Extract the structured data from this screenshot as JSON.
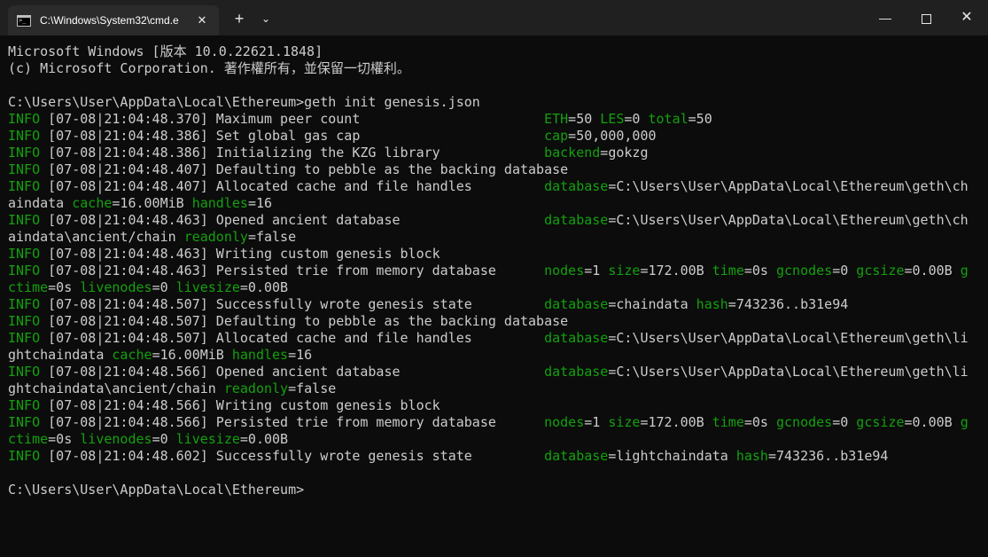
{
  "window": {
    "tab_title": "C:\\Windows\\System32\\cmd.e",
    "tab_close": "✕",
    "new_tab": "+",
    "dropdown": "⌄",
    "minimize": "—",
    "close": "✕"
  },
  "colors": {
    "background": "#0c0c0c",
    "text": "#cccccc",
    "green": "#13a10e",
    "titlebar": "#202020"
  },
  "lines": [
    {
      "segs": [
        {
          "t": "Microsoft Windows [版本 10.0.22621.1848]"
        }
      ]
    },
    {
      "segs": [
        {
          "t": "(c) Microsoft Corporation. 著作權所有，並保留一切權利。"
        }
      ]
    },
    {
      "segs": [
        {
          "t": ""
        }
      ]
    },
    {
      "segs": [
        {
          "t": "C:\\Users\\User\\AppData\\Local\\Ethereum>geth init genesis.json"
        }
      ]
    },
    {
      "segs": [
        {
          "t": "INFO",
          "c": "lv"
        },
        {
          "t": " [07-08|21:04:48.370] Maximum peer count                       "
        },
        {
          "t": "ETH",
          "c": "k"
        },
        {
          "t": "=50 "
        },
        {
          "t": "LES",
          "c": "k"
        },
        {
          "t": "=0 "
        },
        {
          "t": "total",
          "c": "k"
        },
        {
          "t": "=50"
        }
      ]
    },
    {
      "segs": [
        {
          "t": "INFO",
          "c": "lv"
        },
        {
          "t": " [07-08|21:04:48.386] Set global gas cap                       "
        },
        {
          "t": "cap",
          "c": "k"
        },
        {
          "t": "=50,000,000"
        }
      ]
    },
    {
      "segs": [
        {
          "t": "INFO",
          "c": "lv"
        },
        {
          "t": " [07-08|21:04:48.386] Initializing the KZG library             "
        },
        {
          "t": "backend",
          "c": "k"
        },
        {
          "t": "=gokzg"
        }
      ]
    },
    {
      "segs": [
        {
          "t": "INFO",
          "c": "lv"
        },
        {
          "t": " [07-08|21:04:48.407] Defaulting to pebble as the backing database"
        }
      ]
    },
    {
      "segs": [
        {
          "t": "INFO",
          "c": "lv"
        },
        {
          "t": " [07-08|21:04:48.407] Allocated cache and file handles         "
        },
        {
          "t": "database",
          "c": "k"
        },
        {
          "t": "=C:\\Users\\User\\AppData\\Local\\Ethereum\\geth\\ch"
        }
      ]
    },
    {
      "segs": [
        {
          "t": "aindata "
        },
        {
          "t": "cache",
          "c": "k"
        },
        {
          "t": "=16.00MiB "
        },
        {
          "t": "handles",
          "c": "k"
        },
        {
          "t": "=16"
        }
      ]
    },
    {
      "segs": [
        {
          "t": "INFO",
          "c": "lv"
        },
        {
          "t": " [07-08|21:04:48.463] Opened ancient database                  "
        },
        {
          "t": "database",
          "c": "k"
        },
        {
          "t": "=C:\\Users\\User\\AppData\\Local\\Ethereum\\geth\\ch"
        }
      ]
    },
    {
      "segs": [
        {
          "t": "aindata\\ancient/chain "
        },
        {
          "t": "readonly",
          "c": "k"
        },
        {
          "t": "=false"
        }
      ]
    },
    {
      "segs": [
        {
          "t": "INFO",
          "c": "lv"
        },
        {
          "t": " [07-08|21:04:48.463] Writing custom genesis block"
        }
      ]
    },
    {
      "segs": [
        {
          "t": "INFO",
          "c": "lv"
        },
        {
          "t": " [07-08|21:04:48.463] Persisted trie from memory database      "
        },
        {
          "t": "nodes",
          "c": "k"
        },
        {
          "t": "=1 "
        },
        {
          "t": "size",
          "c": "k"
        },
        {
          "t": "=172.00B "
        },
        {
          "t": "time",
          "c": "k"
        },
        {
          "t": "=0s "
        },
        {
          "t": "gcnodes",
          "c": "k"
        },
        {
          "t": "=0 "
        },
        {
          "t": "gcsize",
          "c": "k"
        },
        {
          "t": "=0.00B "
        },
        {
          "t": "g",
          "c": "k"
        }
      ]
    },
    {
      "segs": [
        {
          "t": "ctime",
          "c": "k"
        },
        {
          "t": "=0s "
        },
        {
          "t": "livenodes",
          "c": "k"
        },
        {
          "t": "=0 "
        },
        {
          "t": "livesize",
          "c": "k"
        },
        {
          "t": "=0.00B"
        }
      ]
    },
    {
      "segs": [
        {
          "t": "INFO",
          "c": "lv"
        },
        {
          "t": " [07-08|21:04:48.507] Successfully wrote genesis state         "
        },
        {
          "t": "database",
          "c": "k"
        },
        {
          "t": "=chaindata "
        },
        {
          "t": "hash",
          "c": "k"
        },
        {
          "t": "=743236..b31e94"
        }
      ]
    },
    {
      "segs": [
        {
          "t": "INFO",
          "c": "lv"
        },
        {
          "t": " [07-08|21:04:48.507] Defaulting to pebble as the backing database"
        }
      ]
    },
    {
      "segs": [
        {
          "t": "INFO",
          "c": "lv"
        },
        {
          "t": " [07-08|21:04:48.507] Allocated cache and file handles         "
        },
        {
          "t": "database",
          "c": "k"
        },
        {
          "t": "=C:\\Users\\User\\AppData\\Local\\Ethereum\\geth\\li"
        }
      ]
    },
    {
      "segs": [
        {
          "t": "ghtchaindata "
        },
        {
          "t": "cache",
          "c": "k"
        },
        {
          "t": "=16.00MiB "
        },
        {
          "t": "handles",
          "c": "k"
        },
        {
          "t": "=16"
        }
      ]
    },
    {
      "segs": [
        {
          "t": "INFO",
          "c": "lv"
        },
        {
          "t": " [07-08|21:04:48.566] Opened ancient database                  "
        },
        {
          "t": "database",
          "c": "k"
        },
        {
          "t": "=C:\\Users\\User\\AppData\\Local\\Ethereum\\geth\\li"
        }
      ]
    },
    {
      "segs": [
        {
          "t": "ghtchaindata\\ancient/chain "
        },
        {
          "t": "readonly",
          "c": "k"
        },
        {
          "t": "=false"
        }
      ]
    },
    {
      "segs": [
        {
          "t": "INFO",
          "c": "lv"
        },
        {
          "t": " [07-08|21:04:48.566] Writing custom genesis block"
        }
      ]
    },
    {
      "segs": [
        {
          "t": "INFO",
          "c": "lv"
        },
        {
          "t": " [07-08|21:04:48.566] Persisted trie from memory database      "
        },
        {
          "t": "nodes",
          "c": "k"
        },
        {
          "t": "=1 "
        },
        {
          "t": "size",
          "c": "k"
        },
        {
          "t": "=172.00B "
        },
        {
          "t": "time",
          "c": "k"
        },
        {
          "t": "=0s "
        },
        {
          "t": "gcnodes",
          "c": "k"
        },
        {
          "t": "=0 "
        },
        {
          "t": "gcsize",
          "c": "k"
        },
        {
          "t": "=0.00B "
        },
        {
          "t": "g",
          "c": "k"
        }
      ]
    },
    {
      "segs": [
        {
          "t": "ctime",
          "c": "k"
        },
        {
          "t": "=0s "
        },
        {
          "t": "livenodes",
          "c": "k"
        },
        {
          "t": "=0 "
        },
        {
          "t": "livesize",
          "c": "k"
        },
        {
          "t": "=0.00B"
        }
      ]
    },
    {
      "segs": [
        {
          "t": "INFO",
          "c": "lv"
        },
        {
          "t": " [07-08|21:04:48.602] Successfully wrote genesis state         "
        },
        {
          "t": "database",
          "c": "k"
        },
        {
          "t": "=lightchaindata "
        },
        {
          "t": "hash",
          "c": "k"
        },
        {
          "t": "=743236..b31e94"
        }
      ]
    },
    {
      "segs": [
        {
          "t": ""
        }
      ]
    },
    {
      "segs": [
        {
          "t": "C:\\Users\\User\\AppData\\Local\\Ethereum>"
        }
      ]
    }
  ]
}
